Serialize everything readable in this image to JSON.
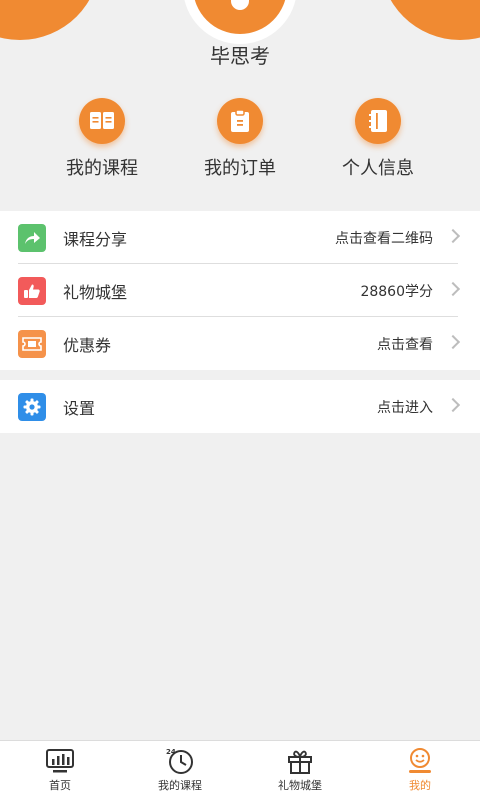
{
  "header": {
    "username": "毕思考"
  },
  "quick_actions": [
    {
      "label": "我的课程",
      "icon": "open-book-icon"
    },
    {
      "label": "我的订单",
      "icon": "clipboard-icon"
    },
    {
      "label": "个人信息",
      "icon": "notebook-icon"
    }
  ],
  "menu": {
    "items": [
      {
        "title": "课程分享",
        "value": "点击查看二维码",
        "icon": "share-arrow-icon",
        "color": "#5cc26d"
      },
      {
        "title": "礼物城堡",
        "value": "28860学分",
        "icon": "thumbs-up-icon",
        "color": "#f25a5a"
      },
      {
        "title": "优惠券",
        "value": "点击查看",
        "icon": "ticket-icon",
        "color": "#f5924a"
      }
    ],
    "settings": {
      "title": "设置",
      "value": "点击进入",
      "icon": "gear-icon",
      "color": "#2f8ee8"
    }
  },
  "tabbar": {
    "tabs": [
      {
        "label": "首页",
        "icon": "monitor-chart-icon",
        "active": false
      },
      {
        "label": "我的课程",
        "icon": "clock-24-icon",
        "active": false
      },
      {
        "label": "礼物城堡",
        "icon": "gift-icon",
        "active": false
      },
      {
        "label": "我的",
        "icon": "smiley-profile-icon",
        "active": true
      }
    ]
  },
  "colors": {
    "accent": "#f08a32",
    "background": "#f0f0f0"
  }
}
